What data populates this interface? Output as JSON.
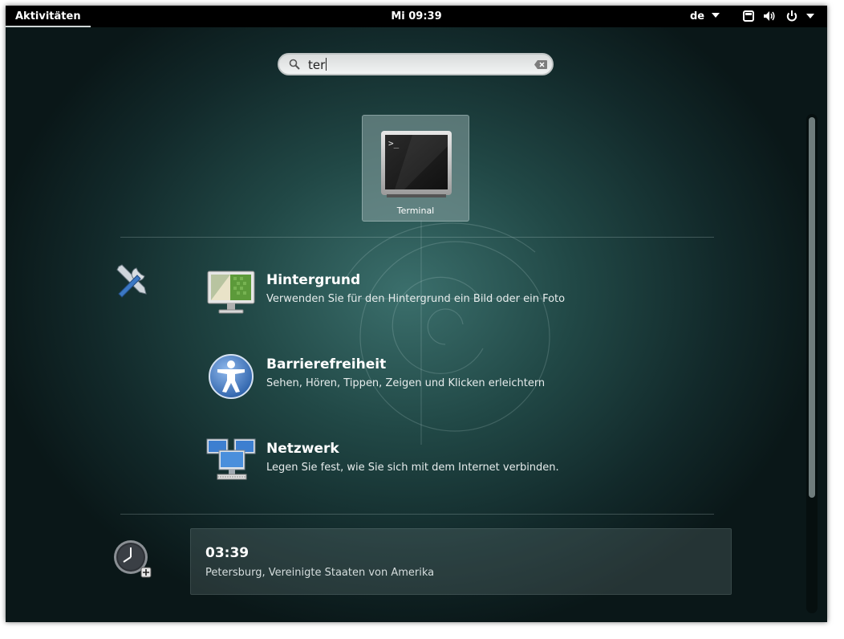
{
  "topbar": {
    "activities_label": "Aktivitäten",
    "clock": "Mi 09:39",
    "keyboard_layout": "de",
    "icons": [
      "window-icon",
      "volume-icon",
      "power-icon",
      "chevron-down-icon"
    ]
  },
  "search": {
    "value": "ter",
    "icon": "search-icon",
    "clear_icon": "clear-icon"
  },
  "app_results": [
    {
      "label": "Terminal",
      "icon": "terminal-icon"
    }
  ],
  "settings_provider": {
    "icon": "settings-tools-icon",
    "results": [
      {
        "title": "Hintergrund",
        "description": "Verwenden Sie für den Hintergrund ein Bild oder ein Foto",
        "icon": "background-icon"
      },
      {
        "title": "Barrierefreiheit",
        "description": "Sehen, Hören, Tippen, Zeigen und Klicken erleichtern",
        "icon": "accessibility-icon"
      },
      {
        "title": "Netzwerk",
        "description": "Legen Sie fest, wie Sie sich mit dem Internet verbinden.",
        "icon": "network-icon"
      }
    ]
  },
  "clocks_provider": {
    "icon": "clock-icon",
    "result": {
      "time": "03:39",
      "place": "Petersburg, Vereinigte Staaten von Amerika"
    }
  },
  "colors": {
    "panel": "#000000",
    "overview_center": "#3b6f6c",
    "overview_edge": "#0a1718",
    "tile": "#8ca5a5"
  }
}
